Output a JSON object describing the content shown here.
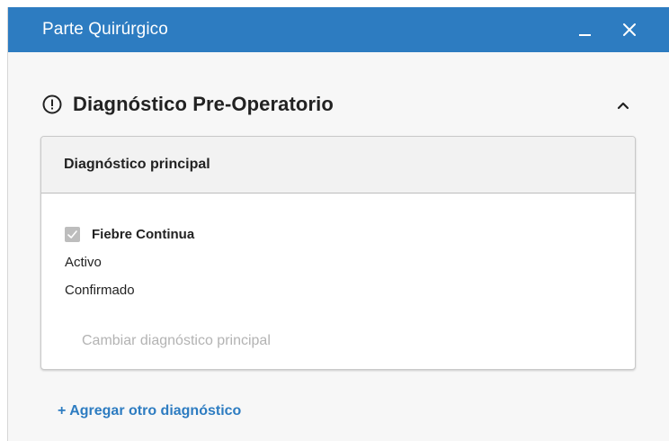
{
  "window": {
    "title": "Parte Quirúrgico"
  },
  "section": {
    "title": "Diagnóstico Pre-Operatorio",
    "icon": "alert-circle-icon"
  },
  "card": {
    "header": "Diagnóstico principal",
    "diagnosis": {
      "name": "Fiebre Continua",
      "checked": true,
      "status": "Activo",
      "verification": "Confirmado"
    },
    "change_label": "Cambiar diagnóstico principal"
  },
  "add_diagnosis_label": "+ Agregar otro diagnóstico",
  "colors": {
    "titlebar": "#2d7cc1",
    "link": "#2d7cc1",
    "disabled_text": "#b3b3b3",
    "checkbox": "#bdbdbd"
  }
}
